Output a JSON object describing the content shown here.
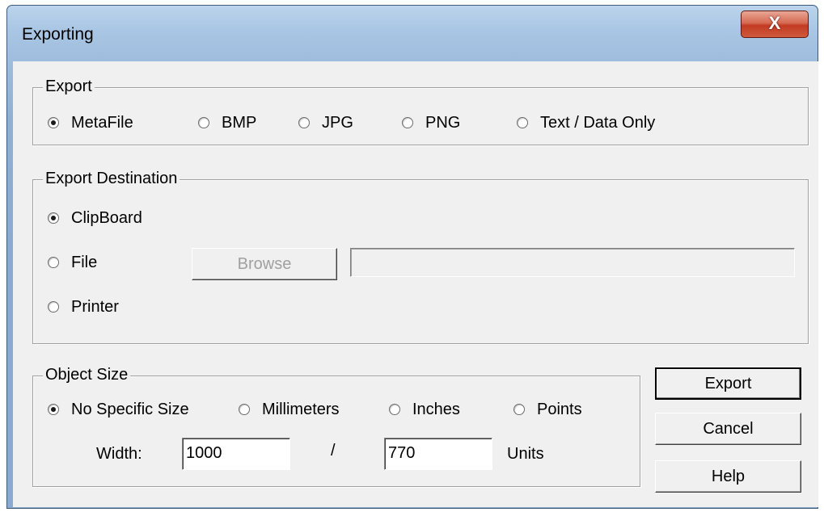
{
  "window": {
    "title": "Exporting",
    "close_label": "X"
  },
  "export_group": {
    "legend": "Export",
    "options": [
      {
        "label": "MetaFile",
        "selected": true
      },
      {
        "label": "BMP",
        "selected": false
      },
      {
        "label": "JPG",
        "selected": false
      },
      {
        "label": "PNG",
        "selected": false
      },
      {
        "label": "Text / Data Only",
        "selected": false
      }
    ]
  },
  "destination_group": {
    "legend": "Export Destination",
    "options": [
      {
        "label": "ClipBoard",
        "selected": true
      },
      {
        "label": "File",
        "selected": false
      },
      {
        "label": "Printer",
        "selected": false
      }
    ],
    "browse_label": "Browse",
    "file_path": ""
  },
  "size_group": {
    "legend": "Object Size",
    "options": [
      {
        "label": "No Specific Size",
        "selected": true
      },
      {
        "label": "Millimeters",
        "selected": false
      },
      {
        "label": "Inches",
        "selected": false
      },
      {
        "label": "Points",
        "selected": false
      }
    ],
    "width_label": "Width:",
    "width_value": "1000",
    "separator": "/",
    "height_value": "770",
    "units_label": "Units"
  },
  "buttons": {
    "export": "Export",
    "cancel": "Cancel",
    "help": "Help"
  }
}
